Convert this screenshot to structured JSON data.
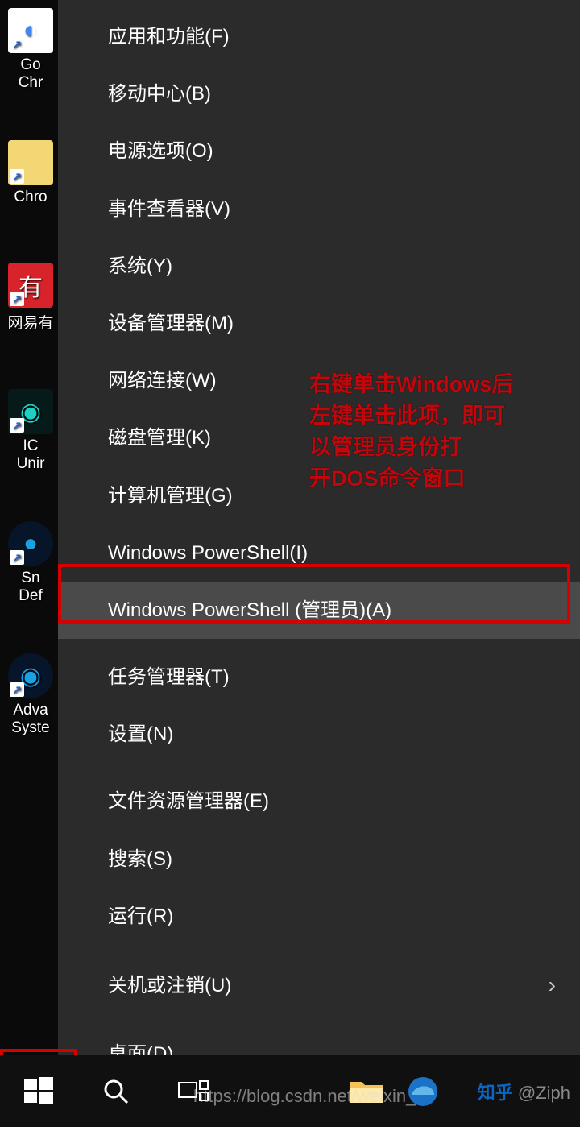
{
  "desktop_icons": [
    {
      "label": "Go\nChr",
      "color": "#fff",
      "icon": "◐"
    },
    {
      "label": "Chro",
      "color": "#f3d774",
      "icon": "▮"
    },
    {
      "label": "网易有",
      "color": "#d8232a",
      "icon": "有"
    },
    {
      "label": "IC\nUnir",
      "color": "#0a3a3a",
      "icon": "◉"
    },
    {
      "label": "Sn\nDef",
      "color": "#0a3a6a",
      "icon": "●"
    },
    {
      "label": "Adva\nSyste",
      "color": "#0a3a6a",
      "icon": "◉"
    }
  ],
  "menu_groups": [
    [
      {
        "label": "应用和功能(F)"
      },
      {
        "label": "移动中心(B)"
      },
      {
        "label": "电源选项(O)"
      },
      {
        "label": "事件查看器(V)"
      },
      {
        "label": "系统(Y)"
      },
      {
        "label": "设备管理器(M)"
      },
      {
        "label": "网络连接(W)"
      },
      {
        "label": "磁盘管理(K)"
      },
      {
        "label": "计算机管理(G)"
      },
      {
        "label": "Windows PowerShell(I)"
      },
      {
        "label": "Windows PowerShell (管理员)(A)",
        "hover": true
      }
    ],
    [
      {
        "label": "任务管理器(T)"
      },
      {
        "label": "设置(N)"
      }
    ],
    [
      {
        "label": "文件资源管理器(E)"
      },
      {
        "label": "搜索(S)"
      },
      {
        "label": "运行(R)"
      }
    ],
    [
      {
        "label": "关机或注销(U)",
        "submenu": true
      }
    ],
    [
      {
        "label": "桌面(D)"
      }
    ]
  ],
  "annotation": "右键单击Windows后\n左键单击此项，即可\n以管理员身份打\n开DOS命令窗口",
  "watermark": "https://blog.csdn.net/weixin_",
  "zhihu": {
    "label": "知乎",
    "user": "@Ziph"
  }
}
